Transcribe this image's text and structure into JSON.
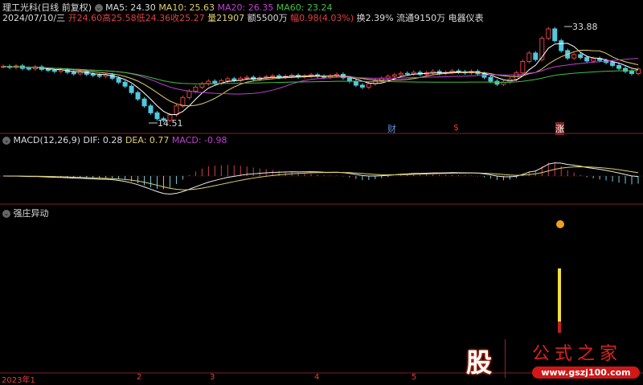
{
  "header": {
    "title": "理工光科(日线 前复权)",
    "ma5": "MA5: 24.30",
    "ma10": "MA10: 25.63",
    "ma20": "MA20: 26.35",
    "ma60": "MA60: 23.24",
    "date": "2024/07/10/三",
    "open": "开24.60",
    "high": "高25.58",
    "low": "低24.36",
    "close": "收25.27",
    "vol": "量21907",
    "amount": "额5500万",
    "change": "幅0.98(4.03%)",
    "turnover": "换2.39%",
    "float": "流通9150万",
    "industry": "电器仪表"
  },
  "price_labels": {
    "high": "33.88",
    "low": "14.51"
  },
  "markers": [
    "财",
    "$",
    "涨"
  ],
  "macd": {
    "title": "MACD(12,26,9)",
    "dif": "DIF: 0.28",
    "dea": "DEA: 0.77",
    "macd": "MACD: -0.98"
  },
  "indicator": {
    "title": "强庄异动"
  },
  "xaxis": [
    "2023年1",
    "2",
    "3",
    "4",
    "5"
  ],
  "watermark": {
    "logo": "股",
    "name": "公式之家",
    "url": "www.gszj100.com"
  },
  "colors": {
    "up": "#e04040",
    "down": "#50c8e0",
    "ma5": "#ffffff",
    "ma10": "#e0d070",
    "ma20": "#c040d0",
    "ma60": "#40c040"
  },
  "chart_data": {
    "type": "candlestick",
    "closes": [
      25.8,
      25.6,
      25.9,
      25.4,
      25.3,
      25.7,
      25.2,
      25.0,
      24.8,
      25.1,
      24.6,
      24.3,
      24.7,
      24.2,
      24.0,
      23.8,
      24.1,
      23.4,
      22.6,
      21.8,
      20.5,
      19.2,
      17.8,
      16.4,
      15.2,
      14.9,
      16.0,
      17.8,
      19.5,
      20.8,
      21.6,
      22.3,
      22.8,
      22.4,
      22.9,
      23.3,
      23.0,
      23.4,
      23.6,
      23.2,
      23.5,
      23.7,
      23.9,
      23.6,
      23.8,
      24.0,
      23.7,
      23.9,
      24.1,
      23.8,
      23.6,
      23.9,
      24.2,
      23.5,
      22.8,
      22.0,
      21.6,
      22.3,
      22.9,
      23.4,
      23.8,
      24.1,
      24.4,
      24.3,
      24.6,
      24.2,
      24.5,
      24.8,
      24.4,
      24.6,
      24.9,
      24.7,
      24.5,
      24.8,
      24.3,
      23.6,
      22.8,
      22.2,
      22.6,
      23.2,
      24.5,
      26.8,
      28.5,
      27.2,
      31.5,
      33.4,
      31.0,
      29.0,
      27.5,
      28.2,
      27.6,
      26.9,
      27.4,
      27.0,
      26.6,
      26.0,
      25.4,
      24.8,
      24.36,
      25.27
    ]
  }
}
